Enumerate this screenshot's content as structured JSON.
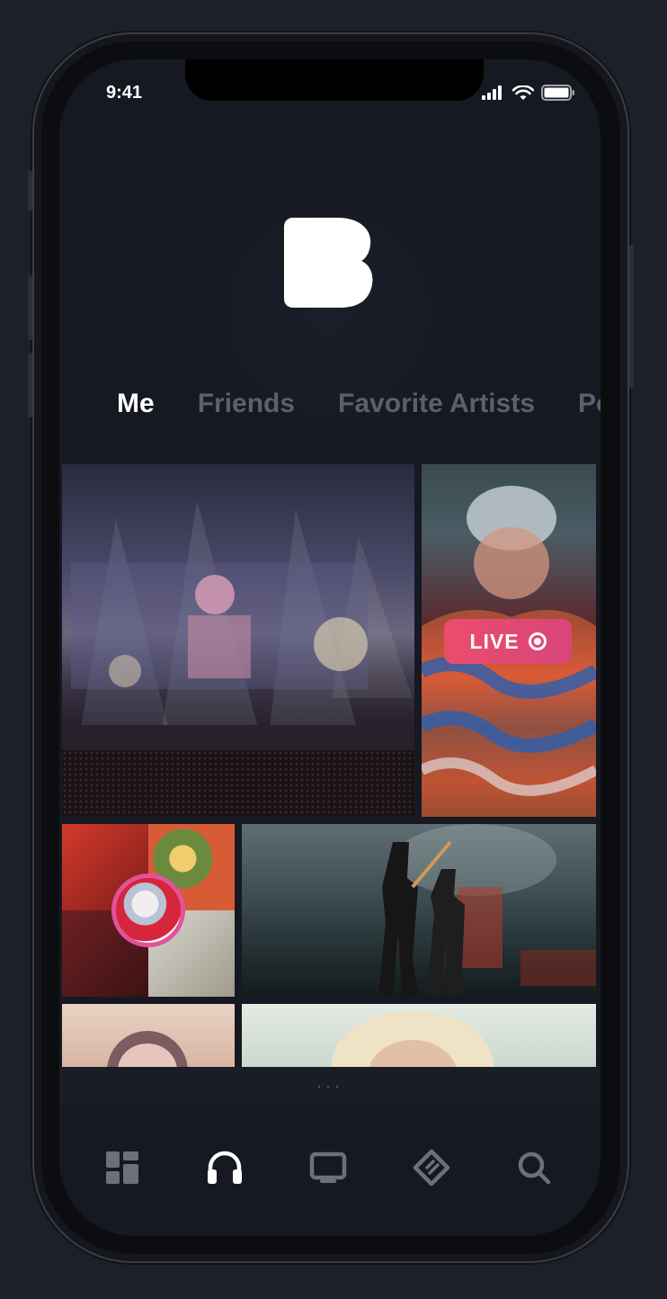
{
  "status_bar": {
    "time": "9:41"
  },
  "app": {
    "logo_letter": "B"
  },
  "tabs": [
    {
      "label": "Me",
      "active": true
    },
    {
      "label": "Friends",
      "active": false
    },
    {
      "label": "Favorite Artists",
      "active": false
    },
    {
      "label": "Po",
      "active": false
    }
  ],
  "feed": {
    "live_badge": "LIVE"
  },
  "sheet_handle": "···",
  "bottom_nav": [
    {
      "icon": "dashboard-icon",
      "active": false
    },
    {
      "icon": "headphones-icon",
      "active": true
    },
    {
      "icon": "tv-icon",
      "active": false
    },
    {
      "icon": "ticket-icon",
      "active": false
    },
    {
      "icon": "search-icon",
      "active": false
    }
  ],
  "colors": {
    "background": "#1d202a",
    "screen": "#161922",
    "accent_live": "#ea4d6c",
    "accent_avatar_ring": "#e4519a",
    "tab_inactive": "#5c606b"
  }
}
